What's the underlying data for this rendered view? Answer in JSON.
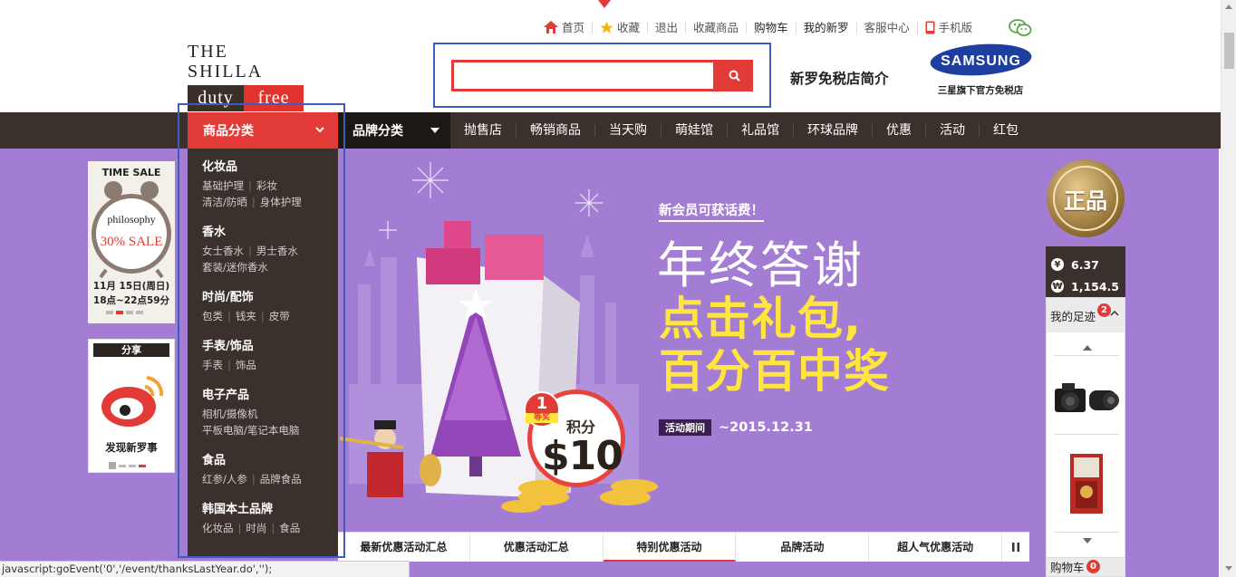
{
  "topbar": {
    "links": [
      "首页",
      "收藏",
      "退出",
      "收藏商品",
      "购物车",
      "我的新罗",
      "客服中心",
      "手机版"
    ]
  },
  "logo": {
    "top": "THE SHILLA",
    "duty": "duty",
    "free": "free"
  },
  "search": {
    "placeholder": "",
    "value": ""
  },
  "header": {
    "intro": "新罗免税店简介",
    "samsung_logo": "SAMSUNG",
    "samsung_sub": "三星旗下官方免税店"
  },
  "nav": {
    "category": "商品分类",
    "brand": "品牌分类",
    "items": [
      "抛售店",
      "畅销商品",
      "当天购",
      "萌娃馆",
      "礼品馆",
      "环球品牌",
      "优惠",
      "活动",
      "红包"
    ]
  },
  "categories": [
    {
      "title": "化妆品",
      "lines": [
        [
          "基础护理",
          "彩妆"
        ],
        [
          "清洁/防晒",
          "身体护理"
        ]
      ]
    },
    {
      "title": "香水",
      "lines": [
        [
          "女士香水",
          "男士香水"
        ],
        [
          "套装/迷你香水"
        ]
      ]
    },
    {
      "title": "时尚/配饰",
      "lines": [
        [
          "包类",
          "钱夹",
          "皮带"
        ]
      ]
    },
    {
      "title": "手表/饰品",
      "lines": [
        [
          "手表",
          "饰品"
        ]
      ]
    },
    {
      "title": "电子产品",
      "lines": [
        [
          "相机/摄像机"
        ],
        [
          "平板电脑/笔记本电脑"
        ]
      ]
    },
    {
      "title": "食品",
      "lines": [
        [
          "红参/人参",
          "品牌食品"
        ]
      ]
    },
    {
      "title": "韩国本土品牌",
      "lines": [
        [
          "化妆品",
          "时尚",
          "食品"
        ]
      ]
    }
  ],
  "timesale": {
    "title": "TIME SALE",
    "brand": "philosophy",
    "sale": "30% SALE",
    "date": "11月 15日(周日)",
    "time": "18点~22点59分"
  },
  "share": {
    "title": "分享",
    "text": "发现新罗事"
  },
  "banner": {
    "member": "新会员可获话费！",
    "title": "年终答谢",
    "gift": "点击礼包,",
    "hundred": "百分百中奖",
    "period_label": "活动期间",
    "period_value": "~2015.12.31",
    "prize_rank": "1",
    "prize_rank_label": "等奖",
    "prize_label": "积分",
    "prize_amount": "$10"
  },
  "tabs": [
    "最新优惠活动汇总",
    "优惠活动汇总",
    "特别优惠活动",
    "品牌活动",
    "超人气优惠活动"
  ],
  "right": {
    "genuine": "正品",
    "rates": [
      {
        "symbol": "¥",
        "value": "6.37"
      },
      {
        "symbol": "₩",
        "value": "1,154.5"
      }
    ],
    "recent_label": "我的足迹",
    "recent_count": "2",
    "cart_label": "购物车",
    "cart_count": "0"
  },
  "statusbar": "javascript:goEvent('0','/event/thanksLastYear.do','');",
  "colors": {
    "accent": "#e23a36",
    "nav": "#3a302c",
    "banner": "#a37dd3",
    "highlight": "#ffe53d"
  }
}
